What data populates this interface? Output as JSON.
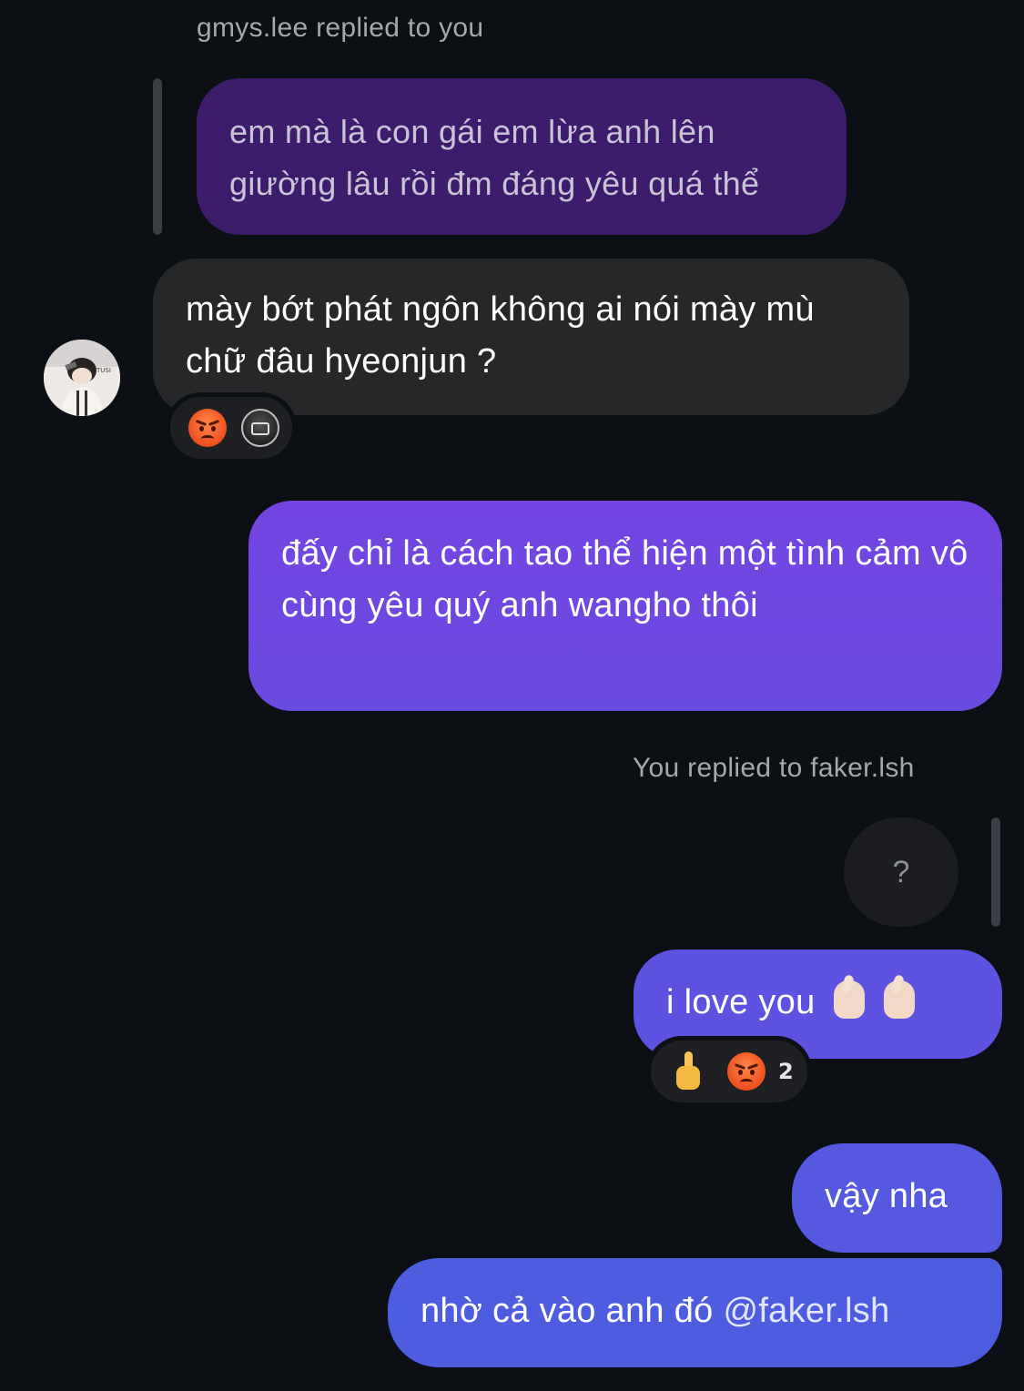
{
  "conversation": {
    "reply_caption_1": "gmys.lee replied to you",
    "quoted_message": "em mà là con gái em lừa anh lên giường lâu rồi đm đáng yêu quá thể",
    "incoming_message": "mày bớt phát ngôn không ai nói mày mù chữ đâu hyeonjun ?",
    "incoming_reactions": [
      "angry-face-emoji",
      "user-avatar-reaction"
    ],
    "outgoing_message_1": "đấy chỉ là cách tao thể hiện một tình cảm vô cùng yêu quý anh wangho thôi",
    "reply_caption_2": "You replied to faker.lsh",
    "quoted_reply": "?",
    "outgoing_message_2": "i love you",
    "outgoing_message_2_emojis": [
      "finger-heart-emoji",
      "finger-heart-emoji"
    ],
    "outgoing_message_2_reactions": [
      "middle-finger-emoji",
      "angry-face-emoji"
    ],
    "outgoing_message_2_reaction_count": "2",
    "outgoing_message_3": "vậy nha",
    "outgoing_message_4_text": "nhờ cả vào anh đó ",
    "outgoing_message_4_mention": "@faker.lsh"
  },
  "colors": {
    "background": "#0c0f14",
    "quoted_bubble": "#3d1c6c",
    "incoming_bubble": "#262729",
    "outgoing_purple": "#7444e1",
    "outgoing_indigo": "#5559df",
    "caption_gray": "#a4a8ae"
  }
}
